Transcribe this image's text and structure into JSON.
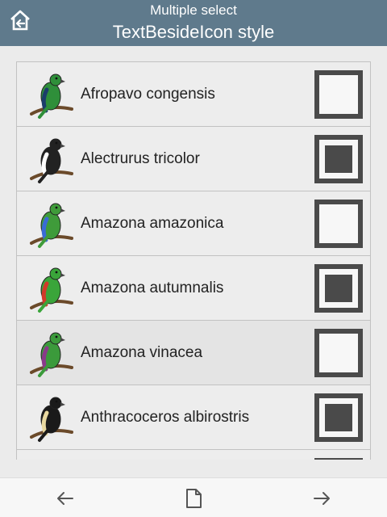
{
  "header": {
    "subtitle": "Multiple select",
    "title": "TextBesideIcon style",
    "home_icon": "home-icon"
  },
  "items": [
    {
      "label": "Afropavo congensis",
      "checked": false,
      "icon": "peacock-bird-icon",
      "colors": [
        "#2f8f3a",
        "#1c3d6b"
      ]
    },
    {
      "label": "Alectrurus tricolor",
      "checked": true,
      "icon": "tyrant-bird-icon",
      "colors": [
        "#222222",
        "#ffffff"
      ]
    },
    {
      "label": "Amazona amazonica",
      "checked": false,
      "icon": "parrot-icon",
      "colors": [
        "#3f9b3a",
        "#3a6bd6"
      ]
    },
    {
      "label": "Amazona autumnalis",
      "checked": true,
      "icon": "parrot-icon",
      "colors": [
        "#3aa53a",
        "#d23a2a"
      ]
    },
    {
      "label": "Amazona vinacea",
      "checked": false,
      "icon": "parrot-icon",
      "colors": [
        "#3b9a3b",
        "#8a3a8a"
      ]
    },
    {
      "label": "Anthracoceros albirostris",
      "checked": true,
      "icon": "hornbill-icon",
      "colors": [
        "#1a1a1a",
        "#e8d8a0"
      ]
    }
  ],
  "footer": {
    "back_icon": "arrow-left-icon",
    "page_icon": "document-icon",
    "forward_icon": "arrow-right-icon"
  },
  "colors": {
    "header_bg": "#5f7a8c",
    "checkbox": "#4a4a4a"
  }
}
